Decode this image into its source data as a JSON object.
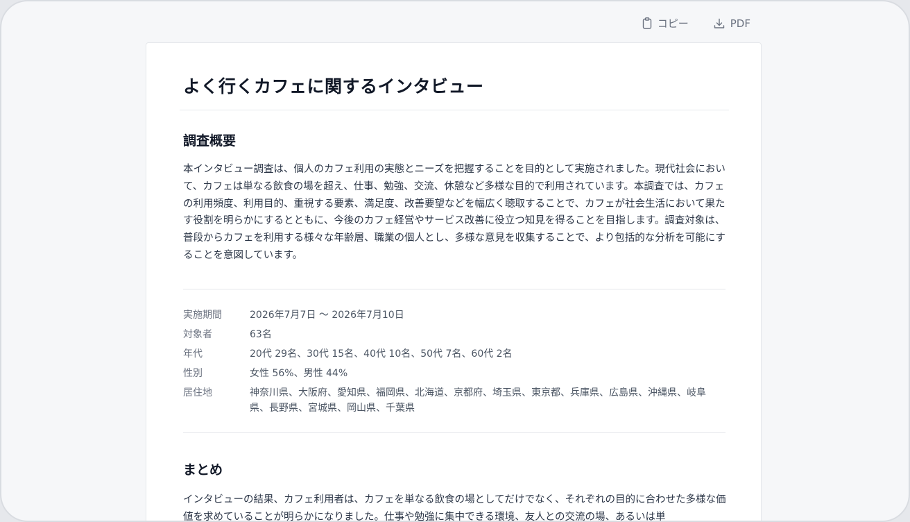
{
  "toolbar": {
    "copy_label": "コピー",
    "pdf_label": "PDF"
  },
  "document": {
    "title": "よく行くカフェに関するインタビュー",
    "overview": {
      "heading": "調査概要",
      "body": "本インタビュー調査は、個人のカフェ利用の実態とニーズを把握することを目的として実施されました。現代社会において、カフェは単なる飲食の場を超え、仕事、勉強、交流、休憩など多様な目的で利用されています。本調査では、カフェの利用頻度、利用目的、重視する要素、満足度、改善要望などを幅広く聴取することで、カフェが社会生活において果たす役割を明らかにするとともに、今後のカフェ経営やサービス改善に役立つ知見を得ることを目指します。調査対象は、普段からカフェを利用する様々な年齢層、職業の個人とし、多様な意見を収集することで、より包括的な分析を可能にすることを意図しています。"
    },
    "info": [
      {
        "label": "実施期間",
        "value": "2026年7月7日 〜 2026年7月10日"
      },
      {
        "label": "対象者",
        "value": "63名"
      },
      {
        "label": "年代",
        "value": "20代 29名、30代 15名、40代 10名、50代 7名、60代 2名"
      },
      {
        "label": "性別",
        "value": "女性 56%、男性 44%"
      },
      {
        "label": "居住地",
        "value": "神奈川県、大阪府、愛知県、福岡県、北海道、京都府、埼玉県、東京都、兵庫県、広島県、沖縄県、岐阜県、長野県、宮城県、岡山県、千葉県"
      }
    ],
    "summary": {
      "heading": "まとめ",
      "body": "インタビューの結果、カフェ利用者は、カフェを単なる飲食の場としてだけでなく、それぞれの目的に合わせた多様な価値を求めていることが明らかになりました。仕事や勉強に集中できる環境、友人との交流の場、あるいは単"
    }
  }
}
